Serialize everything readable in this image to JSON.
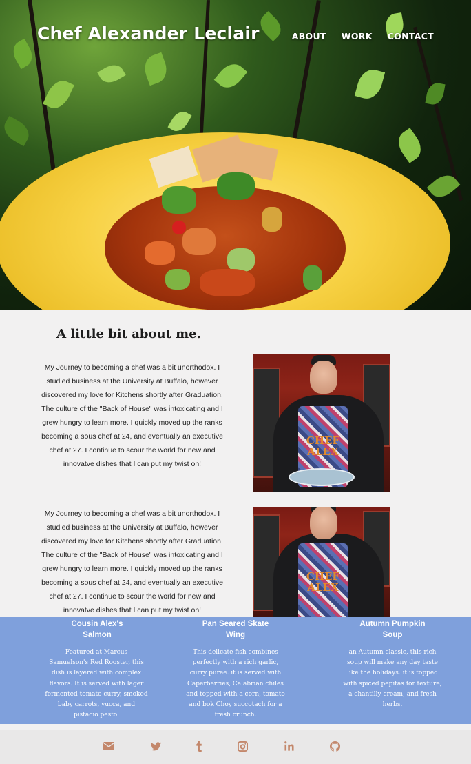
{
  "header": {
    "brand": "Chef Alexander Leclair",
    "nav": [
      "ABOUT",
      "WORK",
      "CONTACT"
    ]
  },
  "about": {
    "title": "A little bit about me.",
    "paragraphs": [
      "My Journey to becoming a chef was a bit unorthodox. I studied business at the University at Buffalo, however discovered my love for Kitchens shortly after Graduation. The culture of the \"Back of House\" was intoxicating and I grew hungry to learn more. I quickly moved up the ranks becoming a sous chef at 24, and eventually an executive chef at 27. I continue to scour the world for new and innovatve dishes that I can put my twist on!",
      "My Journey to becoming a chef was a bit unorthodox. I studied business at the University at Buffalo, however discovered my love for Kitchens shortly after Graduation. The culture of the \"Back of House\" was intoxicating and I grew hungry to learn more. I quickly moved up the ranks becoming a sous chef at 24, and eventually an executive chef at 27. I continue to scour the world for new and innovatve dishes that I can put my twist on!"
    ],
    "apron_text": "CHEF ALEX"
  },
  "dishes": [
    {
      "name": "Cousin Alex's Salmon",
      "description": "Featured at Marcus Samuelson's Red Rooster, this dish is layered with complex flavors. It is served with lager fermented tomato curry, smoked baby carrots, yucca, and pistacio pesto."
    },
    {
      "name": "Pan Seared Skate Wing",
      "description": "This delicate fish combines perfectly with a rich garlic, curry puree. it is served with Caperberries, Calabrian chiles and topped with a corn, tomato and bok Choy succotach for a fresh crunch."
    },
    {
      "name": "Autumn Pumpkin Soup",
      "description": "an Autumn classic, this rich soup will make any day taste like the holidays. it is topped with spiced pepitas for texture, a chantilly cream, and fresh herbs."
    }
  ],
  "footer": {
    "icons": [
      "envelope-icon",
      "twitter-icon",
      "tumblr-icon",
      "instagram-icon",
      "linkedin-icon",
      "github-icon"
    ]
  },
  "colors": {
    "dish_band": "#7fa0dc",
    "footer_icons": "#c3876b",
    "page_bg": "#f2f1f1"
  }
}
